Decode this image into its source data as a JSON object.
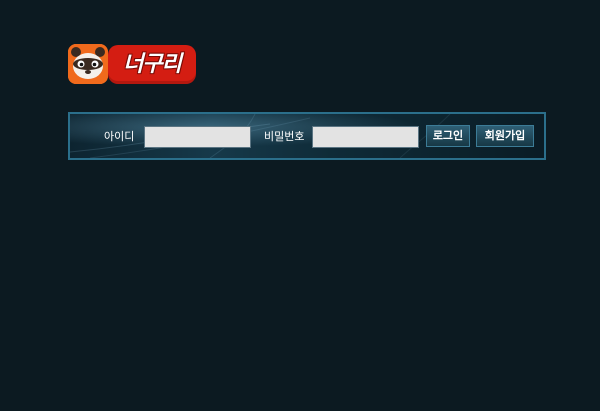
{
  "logo": {
    "text": "너구리",
    "mascot_icon": "raccoon-icon",
    "colors": {
      "mascot_bg": "#f06a1c",
      "word_bg": "#d41d12"
    }
  },
  "login": {
    "id_label": "아이디",
    "id_value": "",
    "password_label": "비밀번호",
    "password_value": "",
    "login_button": "로그인",
    "join_button": "회원가입"
  },
  "colors": {
    "page_bg": "#0c1a21",
    "bar_border": "#2b6f8b",
    "button_bg": "#173845"
  }
}
